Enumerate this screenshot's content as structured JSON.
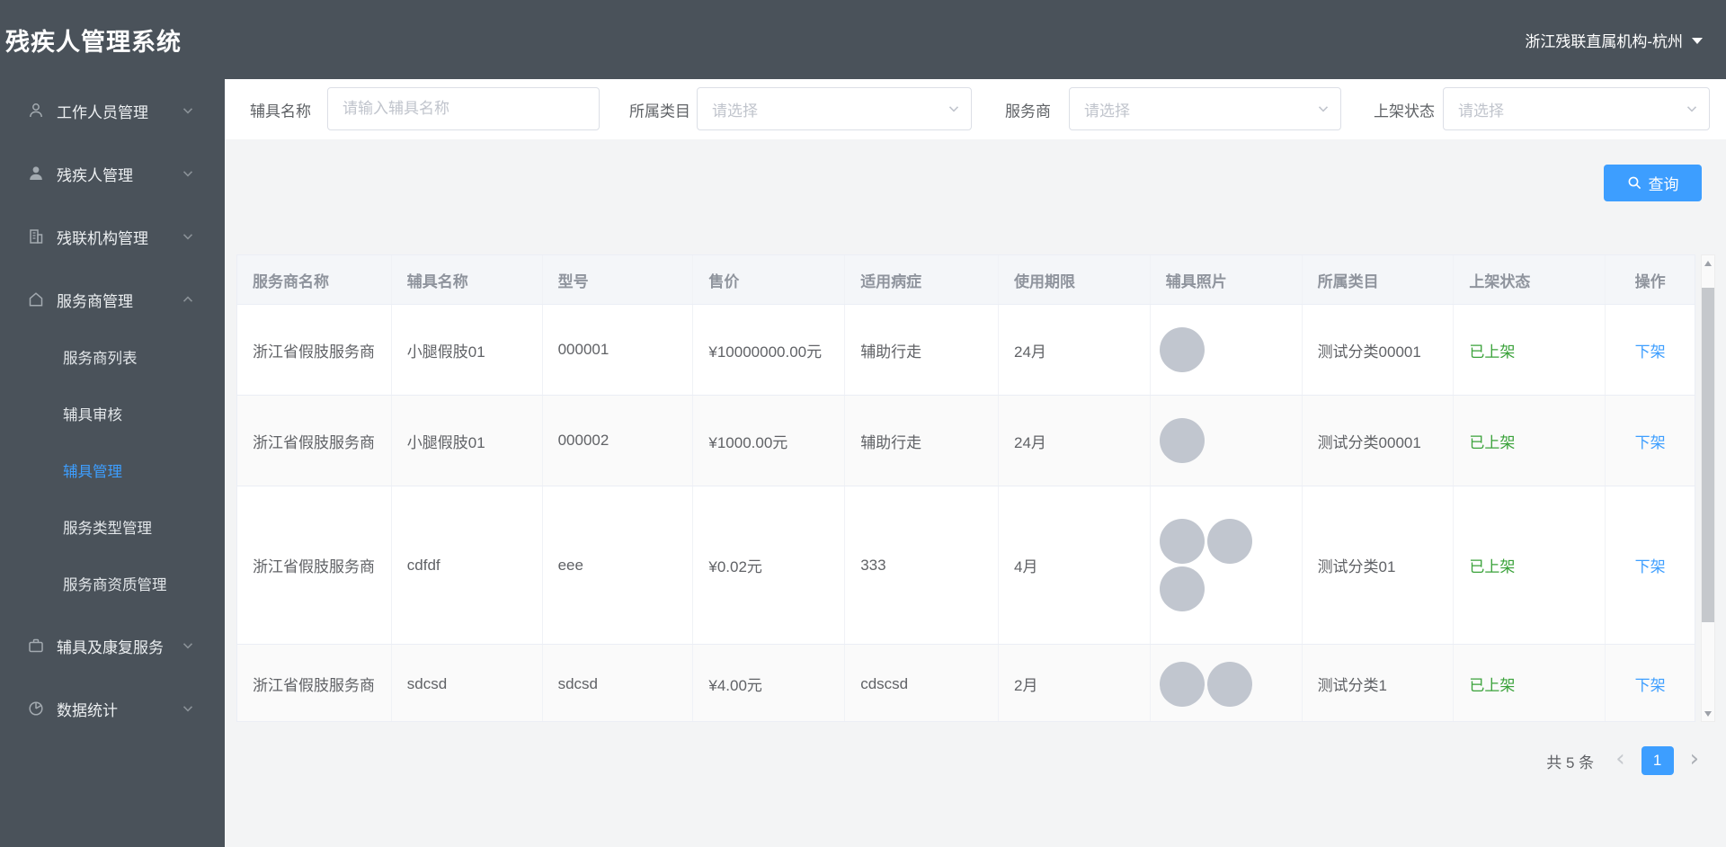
{
  "app": {
    "title": "残疾人管理系统",
    "org_switcher": "浙江残联直属机构-杭州"
  },
  "sidebar": {
    "items": [
      {
        "label": "工作人员管理",
        "icon": "user-outline-icon",
        "expanded": false
      },
      {
        "label": "残疾人管理",
        "icon": "user-filled-icon",
        "expanded": false
      },
      {
        "label": "残联机构管理",
        "icon": "building-icon",
        "expanded": false
      },
      {
        "label": "服务商管理",
        "icon": "home-icon",
        "expanded": true,
        "children": [
          "服务商列表",
          "辅具审核",
          "辅具管理",
          "服务类型管理",
          "服务商资质管理"
        ],
        "active_child": "辅具管理"
      },
      {
        "label": "辅具及康复服务",
        "icon": "briefcase-icon",
        "expanded": false
      },
      {
        "label": "数据统计",
        "icon": "pie-chart-icon",
        "expanded": false
      }
    ]
  },
  "filters": [
    {
      "label": "辅具名称",
      "type": "input",
      "placeholder": "请输入辅具名称"
    },
    {
      "label": "所属类目",
      "type": "select",
      "placeholder": "请选择"
    },
    {
      "label": "服务商",
      "type": "select",
      "placeholder": "请选择"
    },
    {
      "label": "上架状态",
      "type": "select",
      "placeholder": "请选择"
    }
  ],
  "query_button_label": "查询",
  "table": {
    "columns": [
      "服务商名称",
      "辅具名称",
      "型号",
      "售价",
      "适用病症",
      "使用期限",
      "辅具照片",
      "所属类目",
      "上架状态",
      "操作"
    ],
    "rows": [
      {
        "provider": "浙江省假肢服务商",
        "name": "小腿假肢01",
        "model": "000001",
        "price": "¥10000000.00元",
        "disease": "辅助行走",
        "period": "24月",
        "photos": 1,
        "category": "测试分类00001",
        "status": "已上架",
        "action": "下架"
      },
      {
        "provider": "浙江省假肢服务商",
        "name": "小腿假肢01",
        "model": "000002",
        "price": "¥1000.00元",
        "disease": "辅助行走",
        "period": "24月",
        "photos": 1,
        "category": "测试分类00001",
        "status": "已上架",
        "action": "下架"
      },
      {
        "provider": "浙江省假肢服务商",
        "name": "cdfdf",
        "model": "eee",
        "price": "¥0.02元",
        "disease": "333",
        "period": "4月",
        "photos": 3,
        "category": "测试分类01",
        "status": "已上架",
        "action": "下架"
      },
      {
        "provider": "浙江省假肢服务商",
        "name": "sdcsd",
        "model": "sdcsd",
        "price": "¥4.00元",
        "disease": "cdscsd",
        "period": "2月",
        "photos": 2,
        "category": "测试分类1",
        "status": "已上架",
        "action": "下架"
      }
    ]
  },
  "pagination": {
    "total_label": "共 5 条",
    "current_page": "1"
  },
  "colors": {
    "sidebar_dark": "#4a525a",
    "primary_blue": "#3d9eff",
    "success_green": "#3aa23a",
    "table_header_bg": "#f4f6f9",
    "stripe_bg": "#fafafa",
    "photo_placeholder_gray": "#c1c6cf"
  }
}
